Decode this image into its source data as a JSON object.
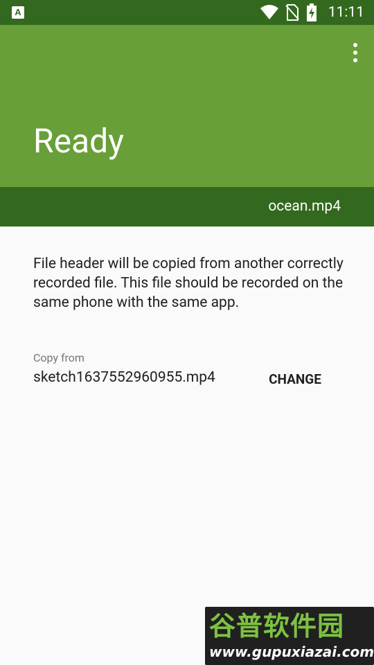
{
  "status_bar": {
    "app_badge": "A",
    "time": "11:11",
    "icons": [
      "wifi-icon",
      "no-sim-icon",
      "battery-charging-icon"
    ]
  },
  "app_bar": {
    "title": "Ready",
    "menu_icon": "more-vert-icon"
  },
  "file_bar": {
    "filename": "ocean.mp4"
  },
  "content": {
    "description": "File header will be copied from another correctly recorded file. This file should be recorded on the same phone with the same app.",
    "copy_from_label": "Copy from",
    "copy_from_file": "sketch1637552960955.mp4",
    "change_button": "CHANGE"
  },
  "watermark": {
    "chinese": "谷普软件园",
    "url": "www.gupuxiazai.com"
  },
  "colors": {
    "primary": "#689f38",
    "primary_dark": "#33691e",
    "background": "#fafafa",
    "text": "#212121",
    "secondary_text": "#757575"
  }
}
